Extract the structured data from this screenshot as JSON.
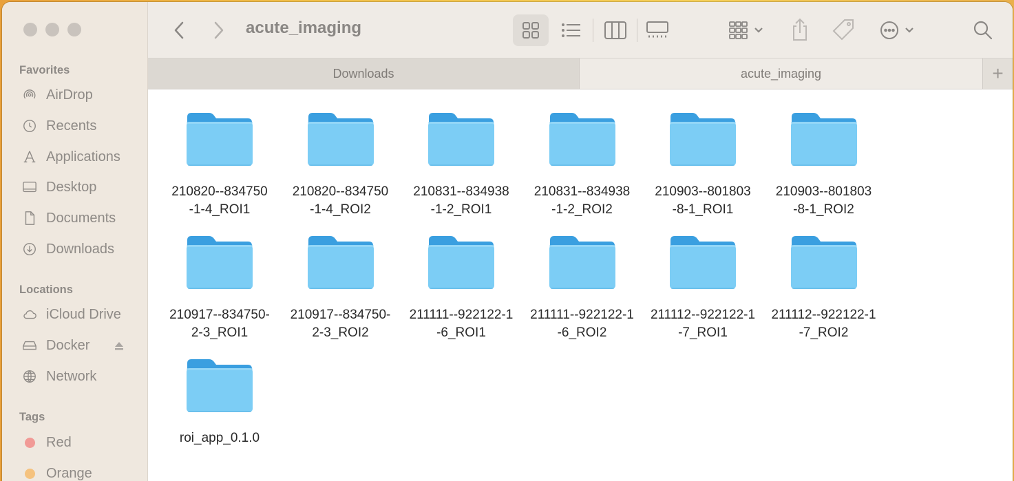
{
  "window": {
    "title": "acute_imaging"
  },
  "sidebar": {
    "favorites_header": "Favorites",
    "favorites": [
      {
        "label": "AirDrop",
        "icon": "airdrop-icon"
      },
      {
        "label": "Recents",
        "icon": "clock-icon"
      },
      {
        "label": "Applications",
        "icon": "applications-icon"
      },
      {
        "label": "Desktop",
        "icon": "desktop-icon"
      },
      {
        "label": "Documents",
        "icon": "document-icon"
      },
      {
        "label": "Downloads",
        "icon": "download-icon"
      }
    ],
    "locations_header": "Locations",
    "locations": [
      {
        "label": "iCloud Drive",
        "icon": "cloud-icon"
      },
      {
        "label": "Docker",
        "icon": "drive-icon"
      },
      {
        "label": "Network",
        "icon": "globe-icon"
      }
    ],
    "tags_header": "Tags",
    "tags": [
      {
        "label": "Red",
        "color": "#f19a96"
      },
      {
        "label": "Orange",
        "color": "#f5c27e"
      }
    ]
  },
  "tabs": [
    {
      "label": "Downloads",
      "active": false
    },
    {
      "label": "acute_imaging",
      "active": true
    }
  ],
  "colors": {
    "folder_front": "#7ccdf5",
    "folder_back": "#3a9fe0",
    "sidebar_text": "#8e8a86"
  },
  "files": [
    {
      "name": "210820--834750\n-1-4_ROI1"
    },
    {
      "name": "210820--834750\n-1-4_ROI2"
    },
    {
      "name": "210831--834938\n-1-2_ROI1"
    },
    {
      "name": "210831--834938\n-1-2_ROI2"
    },
    {
      "name": "210903--801803\n-8-1_ROI1"
    },
    {
      "name": "210903--801803\n-8-1_ROI2"
    },
    {
      "name": "210917--834750-\n2-3_ROI1"
    },
    {
      "name": "210917--834750-\n2-3_ROI2"
    },
    {
      "name": "211111--922122-1\n-6_ROI1"
    },
    {
      "name": "211111--922122-1\n-6_ROI2"
    },
    {
      "name": "211112--922122-1\n-7_ROI1"
    },
    {
      "name": "211112--922122-1\n-7_ROI2"
    },
    {
      "name": "roi_app_0.1.0"
    }
  ]
}
